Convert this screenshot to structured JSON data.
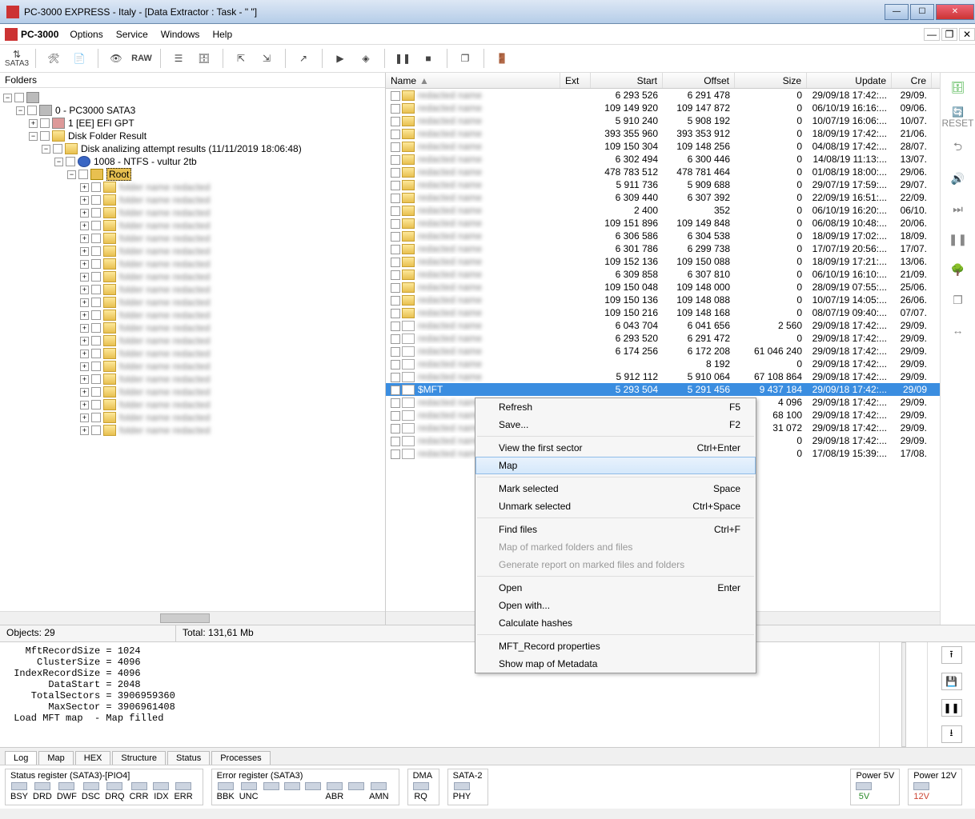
{
  "window": {
    "title": "PC-3000 EXPRESS - Italy - [Data Extractor : Task - \"                       \"]"
  },
  "menubar": {
    "app": "PC-3000",
    "items": [
      "Options",
      "Service",
      "Windows",
      "Help"
    ]
  },
  "toolbar": {
    "sata": "SATA3",
    "raw": "RAW",
    "binocular": "🔍"
  },
  "folders": {
    "title": "Folders",
    "root": "0 - PC3000 SATA3",
    "efi": "1 [EE] EFI GPT",
    "dfr": "Disk Folder Result",
    "dar": "Disk analizing attempt results (11/11/2019 18:06:48)",
    "ntfs": "1008 - NTFS - vultur 2tb",
    "rt": "Root"
  },
  "columns": {
    "name": "Name",
    "ext": "Ext",
    "start": "Start",
    "offset": "Offset",
    "size": "Size",
    "update": "Update",
    "cre": "Cre"
  },
  "files": [
    {
      "t": "d",
      "start": "6 293 526",
      "offset": "6 291 478",
      "size": "0",
      "update": "29/09/18 17:42:...",
      "cre": "29/09."
    },
    {
      "t": "d",
      "start": "109 149 920",
      "offset": "109 147 872",
      "size": "0",
      "update": "06/10/19 16:16:...",
      "cre": "09/06."
    },
    {
      "t": "d",
      "start": "5 910 240",
      "offset": "5 908 192",
      "size": "0",
      "update": "10/07/19 16:06:...",
      "cre": "10/07."
    },
    {
      "t": "d",
      "start": "393 355 960",
      "offset": "393 353 912",
      "size": "0",
      "update": "18/09/19 17:42:...",
      "cre": "21/06."
    },
    {
      "t": "d",
      "start": "109 150 304",
      "offset": "109 148 256",
      "size": "0",
      "update": "04/08/19 17:42:...",
      "cre": "28/07."
    },
    {
      "t": "d",
      "start": "6 302 494",
      "offset": "6 300 446",
      "size": "0",
      "update": "14/08/19 11:13:...",
      "cre": "13/07."
    },
    {
      "t": "d",
      "start": "478 783 512",
      "offset": "478 781 464",
      "size": "0",
      "update": "01/08/19 18:00:...",
      "cre": "29/06."
    },
    {
      "t": "d",
      "start": "5 911 736",
      "offset": "5 909 688",
      "size": "0",
      "update": "29/07/19 17:59:...",
      "cre": "29/07."
    },
    {
      "t": "d",
      "start": "6 309 440",
      "offset": "6 307 392",
      "size": "0",
      "update": "22/09/19 16:51:...",
      "cre": "22/09."
    },
    {
      "t": "d",
      "start": "2 400",
      "offset": "352",
      "size": "0",
      "update": "06/10/19 16:20:...",
      "cre": "06/10."
    },
    {
      "t": "d",
      "start": "109 151 896",
      "offset": "109 149 848",
      "size": "0",
      "update": "06/08/19 10:48:...",
      "cre": "20/06."
    },
    {
      "t": "d",
      "start": "6 306 586",
      "offset": "6 304 538",
      "size": "0",
      "update": "18/09/19 17:02:...",
      "cre": "18/09."
    },
    {
      "t": "d",
      "start": "6 301 786",
      "offset": "6 299 738",
      "size": "0",
      "update": "17/07/19 20:56:...",
      "cre": "17/07."
    },
    {
      "t": "d",
      "start": "109 152 136",
      "offset": "109 150 088",
      "size": "0",
      "update": "18/09/19 17:21:...",
      "cre": "13/06."
    },
    {
      "t": "d",
      "start": "6 309 858",
      "offset": "6 307 810",
      "size": "0",
      "update": "06/10/19 16:10:...",
      "cre": "21/09."
    },
    {
      "t": "d",
      "start": "109 150 048",
      "offset": "109 148 000",
      "size": "0",
      "update": "28/09/19 07:55:...",
      "cre": "25/06."
    },
    {
      "t": "d",
      "start": "109 150 136",
      "offset": "109 148 088",
      "size": "0",
      "update": "10/07/19 14:05:...",
      "cre": "26/06."
    },
    {
      "t": "d",
      "start": "109 150 216",
      "offset": "109 148 168",
      "size": "0",
      "update": "08/07/19 09:40:...",
      "cre": "07/07."
    },
    {
      "t": "f",
      "start": "6 043 704",
      "offset": "6 041 656",
      "size": "2 560",
      "update": "29/09/18 17:42:...",
      "cre": "29/09."
    },
    {
      "t": "f",
      "start": "6 293 520",
      "offset": "6 291 472",
      "size": "0",
      "update": "29/09/18 17:42:...",
      "cre": "29/09."
    },
    {
      "t": "f",
      "start": "6 174 256",
      "offset": "6 172 208",
      "size": "61 046 240",
      "update": "29/09/18 17:42:...",
      "cre": "29/09."
    },
    {
      "t": "f",
      "start": "",
      "offset": "8 192",
      "size": "0",
      "update": "29/09/18 17:42:...",
      "cre": "29/09."
    },
    {
      "t": "f",
      "start": "5 912 112",
      "offset": "5 910 064",
      "size": "67 108 864",
      "update": "29/09/18 17:42:...",
      "cre": "29/09."
    }
  ],
  "selected": {
    "name": "$MFT",
    "start": "5 293 504",
    "offset": "5 291 456",
    "size": "9 437 184",
    "update": "29/09/18 17:42:...",
    "cre": "29/09"
  },
  "after_sel": [
    {
      "t": "f",
      "size": "4 096",
      "update": "29/09/18 17:42:...",
      "cre": "29/09."
    },
    {
      "t": "f",
      "size": "68 100",
      "update": "29/09/18 17:42:...",
      "cre": "29/09."
    },
    {
      "t": "f",
      "size": "31 072",
      "update": "29/09/18 17:42:...",
      "cre": "29/09."
    },
    {
      "t": "f",
      "size": "0",
      "update": "29/09/18 17:42:...",
      "cre": "29/09."
    },
    {
      "t": "f",
      "size": "0",
      "update": "17/08/19 15:39:...",
      "cre": "17/08."
    }
  ],
  "context": [
    {
      "label": "Refresh",
      "sc": "F5"
    },
    {
      "label": "Save...",
      "sc": "F2"
    },
    {
      "sep": true
    },
    {
      "label": "View the first sector",
      "sc": "Ctrl+Enter"
    },
    {
      "label": "Map",
      "hov": true
    },
    {
      "sep": true
    },
    {
      "label": "Mark selected",
      "sc": "Space"
    },
    {
      "label": "Unmark selected",
      "sc": "Ctrl+Space"
    },
    {
      "sep": true
    },
    {
      "label": "Find files",
      "sc": "Ctrl+F"
    },
    {
      "label": "Map of marked folders and files",
      "dis": true
    },
    {
      "label": "Generate report on marked files and folders",
      "dis": true
    },
    {
      "sep": true
    },
    {
      "label": "Open",
      "sc": "Enter"
    },
    {
      "label": "Open with..."
    },
    {
      "label": "Calculate hashes"
    },
    {
      "sep": true
    },
    {
      "label": "MFT_Record properties"
    },
    {
      "label": "Show map of Metadata"
    }
  ],
  "status": {
    "objects": "Objects: 29",
    "total": "Total: 131,61 Mb"
  },
  "log": {
    "lines": "   MftRecordSize = 1024\n     ClusterSize = 4096\n IndexRecordSize = 4096\n       DataStart = 2048\n    TotalSectors = 3906959360\n       MaxSector = 3906961408\n Load MFT map  - Map filled",
    "tabs": [
      "Log",
      "Map",
      "HEX",
      "Structure",
      "Status",
      "Processes"
    ]
  },
  "regs": {
    "status": {
      "title": "Status register (SATA3)-[PIO4]",
      "items": [
        "BSY",
        "DRD",
        "DWF",
        "DSC",
        "DRQ",
        "CRR",
        "IDX",
        "ERR"
      ]
    },
    "error": {
      "title": "Error register (SATA3)",
      "items": [
        "BBK",
        "UNC",
        "",
        "",
        "",
        "ABR",
        "",
        "AMN"
      ]
    },
    "dma": {
      "title": "DMA",
      "items": [
        "RQ"
      ]
    },
    "sata2": {
      "title": "SATA-2",
      "items": [
        "PHY"
      ]
    },
    "p5": {
      "title": "Power 5V",
      "items": [
        "5V"
      ]
    },
    "p12": {
      "title": "Power 12V",
      "items": [
        "12V"
      ]
    }
  },
  "rightbar_reset": "RESET"
}
